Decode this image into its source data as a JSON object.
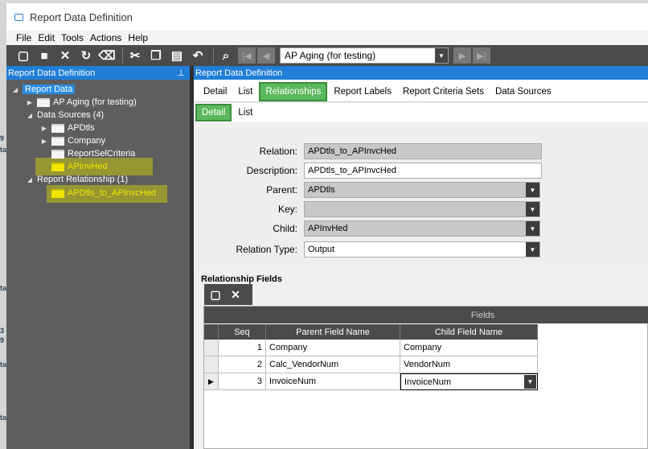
{
  "window": {
    "title": "Report Data Definition"
  },
  "menu": [
    "File",
    "Edit",
    "Tools",
    "Actions",
    "Help"
  ],
  "toolbar": {
    "selector_value": "AP Aging (for testing)"
  },
  "left_panel": {
    "header": "Report Data Definition",
    "tree": {
      "root": "Report Data",
      "report": "AP Aging (for testing)",
      "data_sources": "Data Sources (4)",
      "ds_items": [
        "APDtls",
        "Company",
        "ReportSelCriteria",
        "APInvHed"
      ],
      "relationships": "Report Relationship (1)",
      "rel_items": [
        "APDtls_to_APInvcHed"
      ]
    }
  },
  "right_panel": {
    "header": "Report Data Definition",
    "tabs": [
      "Detail",
      "List",
      "Relationships",
      "Report Labels",
      "Report Criteria Sets",
      "Data Sources"
    ],
    "active_tab": "Relationships",
    "subtabs": [
      "Detail",
      "List"
    ],
    "active_subtab": "Detail",
    "form": {
      "relation_label": "Relation:",
      "relation_value": "APDtls_to_APInvcHed",
      "description_label": "Description:",
      "description_value": "APDtls_to_APInvcHed",
      "parent_label": "Parent:",
      "parent_value": "APDtls",
      "key_label": "Key:",
      "key_value": "",
      "child_label": "Child:",
      "child_value": "APInvHed",
      "relation_type_label": "Relation Type:",
      "relation_type_value": "Output"
    },
    "relationship_fields": {
      "title": "Relationship Fields",
      "group_header": "Fields",
      "columns": [
        "Seq",
        "Parent Field Name",
        "Child Field Name"
      ],
      "rows": [
        {
          "seq": "1",
          "parent": "Company",
          "child": "Company"
        },
        {
          "seq": "2",
          "parent": "Calc_VendorNum",
          "child": "VendorNum"
        },
        {
          "seq": "3",
          "parent": "InvoiceNum",
          "child": "InvoiceNum"
        }
      ]
    }
  }
}
